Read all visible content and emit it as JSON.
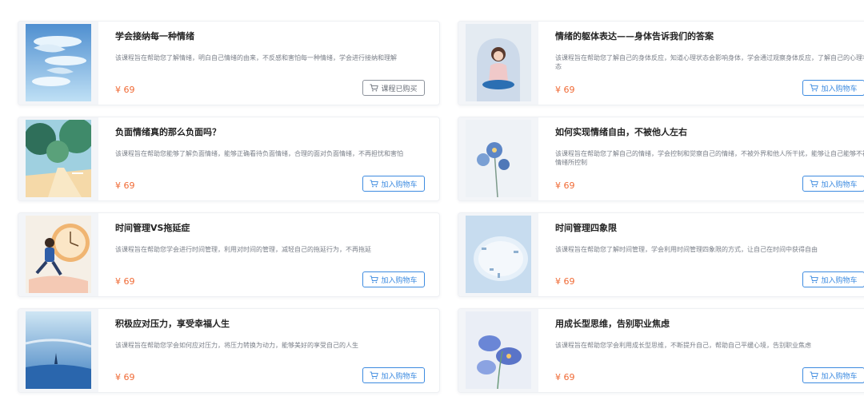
{
  "currency": "¥",
  "courses": [
    {
      "title": "学会接纳每一种情绪",
      "desc": "该课程旨在帮助您了解情绪，明白自己情绪的由来，不反感和害怕每一种情绪，学会进行接纳和理解",
      "price": "¥ 69",
      "button": "课程已购买",
      "purchased": true,
      "image": "whales-sky-image"
    },
    {
      "title": "情绪的躯体表达——身体告诉我们的答案",
      "desc": "该课程旨在帮助您了解自己的身体反应，知道心理状态会影响身体，学会通过观察身体反应，了解自己的心理状态",
      "price": "¥ 69",
      "button": "加入购物车",
      "purchased": false,
      "image": "meditating-woman-image"
    },
    {
      "title": "负面情绪真的那么负面吗？",
      "desc": "该课程旨在帮助您能够了解负面情绪，能够正确看待负面情绪，合理的面对负面情绪，不再担忧和害怕",
      "price": "¥ 69",
      "button": "加入购物车",
      "purchased": false,
      "image": "forest-path-image"
    },
    {
      "title": "如何实现情绪自由，不被他人左右",
      "desc": "该课程旨在帮助您了解自己的情绪，学会控制和觉察自己的情绪，不被外界和他人所干扰，能够让自己能够不被情绪所控制",
      "price": "¥ 69",
      "button": "加入购物车",
      "purchased": false,
      "image": "blue-flowers-image"
    },
    {
      "title": "时间管理VS拖延症",
      "desc": "该课程旨在帮助您学会进行时间管理，利用对时间的管理，减轻自己的拖延行为，不再拖延",
      "price": "¥ 69",
      "button": "加入购物车",
      "purchased": false,
      "image": "man-running-clock-image"
    },
    {
      "title": "时间管理四象限",
      "desc": "该课程旨在帮助您了解时间管理，学会利用时间管理四象限的方式，让自己在时间中获得自由",
      "price": "¥ 69",
      "button": "加入购物车",
      "purchased": false,
      "image": "clock-face-image"
    },
    {
      "title": "积极应对压力，享受幸福人生",
      "desc": "该课程旨在帮助您学会如何应对压力，将压力转换为动力，能够美好的享受自己的人生",
      "price": "¥ 69",
      "button": "加入购物车",
      "purchased": false,
      "image": "ocean-sailboat-image"
    },
    {
      "title": "用成长型思维，告别职业焦虑",
      "desc": "该课程旨在帮助您学会利用成长型思维，不断提升自己，帮助自己平缓心境，告别职业焦虑",
      "price": "¥ 69",
      "button": "加入购物车",
      "purchased": false,
      "image": "blue-iris-image"
    }
  ],
  "colors": {
    "price": "#f06a35",
    "button_active": "#3d8be0",
    "button_bought": "#8d939c"
  },
  "icons": {
    "cart": "cart-icon"
  }
}
